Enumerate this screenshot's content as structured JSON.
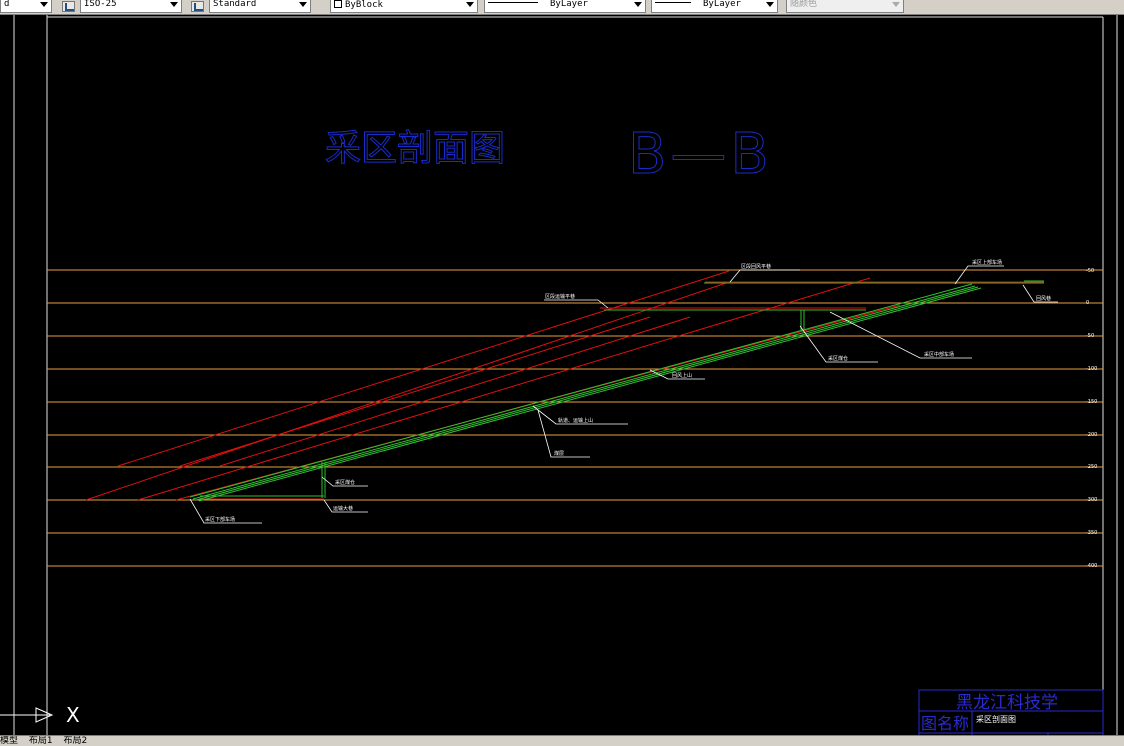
{
  "toolbar": {
    "first_value": "d",
    "dimstyle": "ISO-25",
    "textstyle": "Standard",
    "color": "ByBlock",
    "linetype": "ByLayer",
    "lineweight": "ByLayer",
    "plotstyle": "随颜色"
  },
  "drawing": {
    "title": "采区剖面图",
    "section": "B—B",
    "labels": [
      {
        "id": "district-return-roadway",
        "text": "区段回风平巷"
      },
      {
        "id": "upper-yard",
        "text": "采区上部车场"
      },
      {
        "id": "district-transport-roadway",
        "text": "区段运输平巷"
      },
      {
        "id": "return-roadway",
        "text": "回风巷"
      },
      {
        "id": "mid-yard",
        "text": "采区中部车场"
      },
      {
        "id": "coal-bunker",
        "text": "采区煤仓"
      },
      {
        "id": "return-uphill",
        "text": "回风上山"
      },
      {
        "id": "transport-uphill",
        "text": "轨道、运输上山"
      },
      {
        "id": "coal-seam",
        "text": "煤层"
      },
      {
        "id": "bunker-lower",
        "text": "采区煤仓"
      },
      {
        "id": "transport-roadway",
        "text": "运输大巷"
      },
      {
        "id": "lower-yard",
        "text": "采区下部车场"
      }
    ],
    "levels": [
      "-50",
      "0",
      "-50",
      "-100",
      "-150",
      "-200",
      "-250",
      "-300",
      "-350",
      "-400"
    ]
  },
  "ucs": {
    "x_label": "X"
  },
  "title_block": {
    "school": "黑龙江科技学",
    "name_label": "图名称",
    "name_value": "采区剖面图"
  },
  "tabs": [
    "模型",
    "布局1",
    "布局2"
  ],
  "colors": {
    "level_line": "#e8a040",
    "red_line": "#e01010",
    "green_line": "#30c030",
    "title_blue": "#1a2cc8",
    "title_block": "#2a2ad0",
    "label_white": "#ffffff"
  }
}
